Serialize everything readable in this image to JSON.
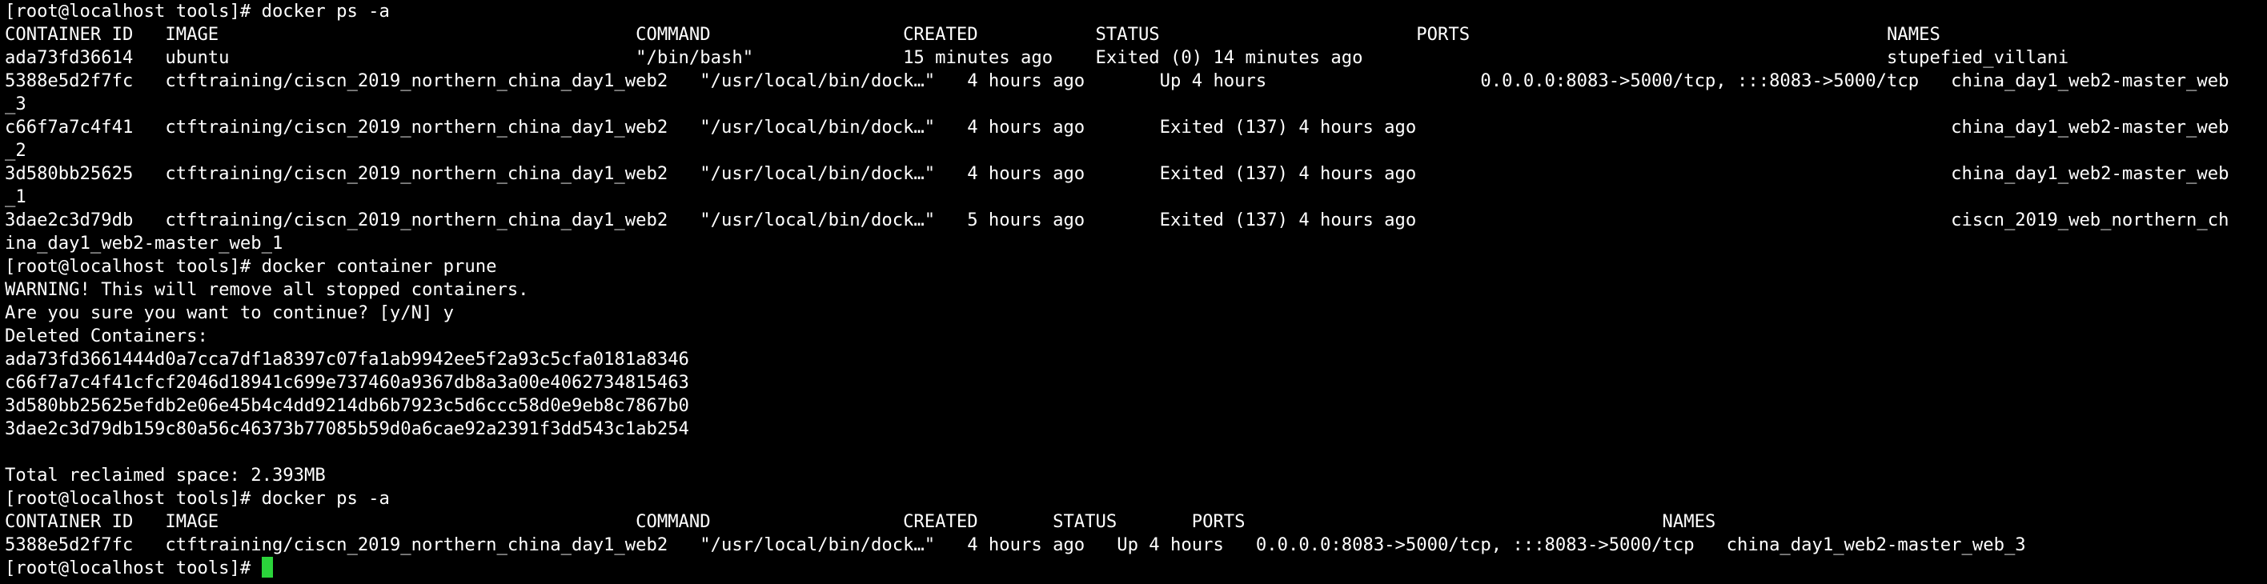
{
  "terminal": {
    "lines": [
      "[root@localhost tools]# docker ps -a",
      "CONTAINER ID   IMAGE                                       COMMAND                  CREATED           STATUS                        PORTS                                       NAMES",
      "ada73fd36614   ubuntu                                      \"/bin/bash\"              15 minutes ago    Exited (0) 14 minutes ago                                                 stupefied_villani",
      "5388e5d2f7fc   ctftraining/ciscn_2019_northern_china_day1_web2   \"/usr/local/bin/dock…\"   4 hours ago       Up 4 hours                    0.0.0.0:8083->5000/tcp, :::8083->5000/tcp   china_day1_web2-master_web",
      "_3",
      "c66f7a7c4f41   ctftraining/ciscn_2019_northern_china_day1_web2   \"/usr/local/bin/dock…\"   4 hours ago       Exited (137) 4 hours ago                                                  china_day1_web2-master_web",
      "_2",
      "3d580bb25625   ctftraining/ciscn_2019_northern_china_day1_web2   \"/usr/local/bin/dock…\"   4 hours ago       Exited (137) 4 hours ago                                                  china_day1_web2-master_web",
      "_1",
      "3dae2c3d79db   ctftraining/ciscn_2019_northern_china_day1_web2   \"/usr/local/bin/dock…\"   5 hours ago       Exited (137) 4 hours ago                                                  ciscn_2019_web_northern_ch",
      "ina_day1_web2-master_web_1",
      "[root@localhost tools]# docker container prune",
      "WARNING! This will remove all stopped containers.",
      "Are you sure you want to continue? [y/N] y",
      "Deleted Containers:",
      "ada73fd3661444d0a7cca7df1a8397c07fa1ab9942ee5f2a93c5cfa0181a8346",
      "c66f7a7c4f41cfcf2046d18941c699e737460a9367db8a3a00e4062734815463",
      "3d580bb25625efdb2e06e45b4c4dd9214db6b7923c5d6ccc58d0e9eb8c7867b0",
      "3dae2c3d79db159c80a56c46373b77085b59d0a6cae92a2391f3dd543c1ab254",
      "",
      "Total reclaimed space: 2.393MB",
      "[root@localhost tools]# docker ps -a",
      "CONTAINER ID   IMAGE                                       COMMAND                  CREATED       STATUS       PORTS                                       NAMES",
      "5388e5d2f7fc   ctftraining/ciscn_2019_northern_china_day1_web2   \"/usr/local/bin/dock…\"   4 hours ago   Up 4 hours   0.0.0.0:8083->5000/tcp, :::8083->5000/tcp   china_day1_web2-master_web_3"
    ],
    "prompt": "[root@localhost tools]# "
  },
  "colors": {
    "background": "#000000",
    "foreground": "#ffffff",
    "cursor": "#2bd43b"
  }
}
